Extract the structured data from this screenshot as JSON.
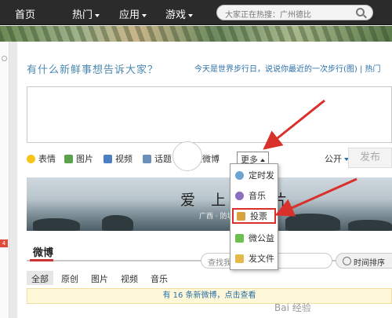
{
  "nav": {
    "home": "首页",
    "hot": "热门",
    "apps": "应用",
    "games": "游戏",
    "search_placeholder": "大家正在热搜：广州德比"
  },
  "composer": {
    "prompt": "有什么新鲜事想告诉大家？",
    "topic_link": "今天是世界步行日，说说你最近的一次步行(图) | 热门"
  },
  "toolbar": {
    "emoji": "表情",
    "picture": "图片",
    "video": "视频",
    "topic": "话题",
    "long_weibo": "长微博",
    "more": "更多",
    "visibility": "公开",
    "publish": "发布"
  },
  "dropdown": {
    "items": [
      "定时发",
      "音乐",
      "投票",
      "微公益",
      "发文件"
    ],
    "highlighted": "投票"
  },
  "cover": {
    "title": "爱 上 一 片",
    "subtitle": "广西 · 防城"
  },
  "feed": {
    "title": "微博",
    "search_placeholder": "查找我",
    "sort": "时间排序",
    "filters": [
      "全部",
      "原创",
      "图片",
      "视频",
      "音乐"
    ],
    "notice": "有 16 条新微博，点击查看"
  },
  "left": {
    "badge": "4"
  },
  "watermark": "Bai 经验",
  "colors": {
    "accent_red": "#d9302c",
    "link_blue": "#2a6fa8",
    "nav_bg": "#2b2b2b"
  }
}
